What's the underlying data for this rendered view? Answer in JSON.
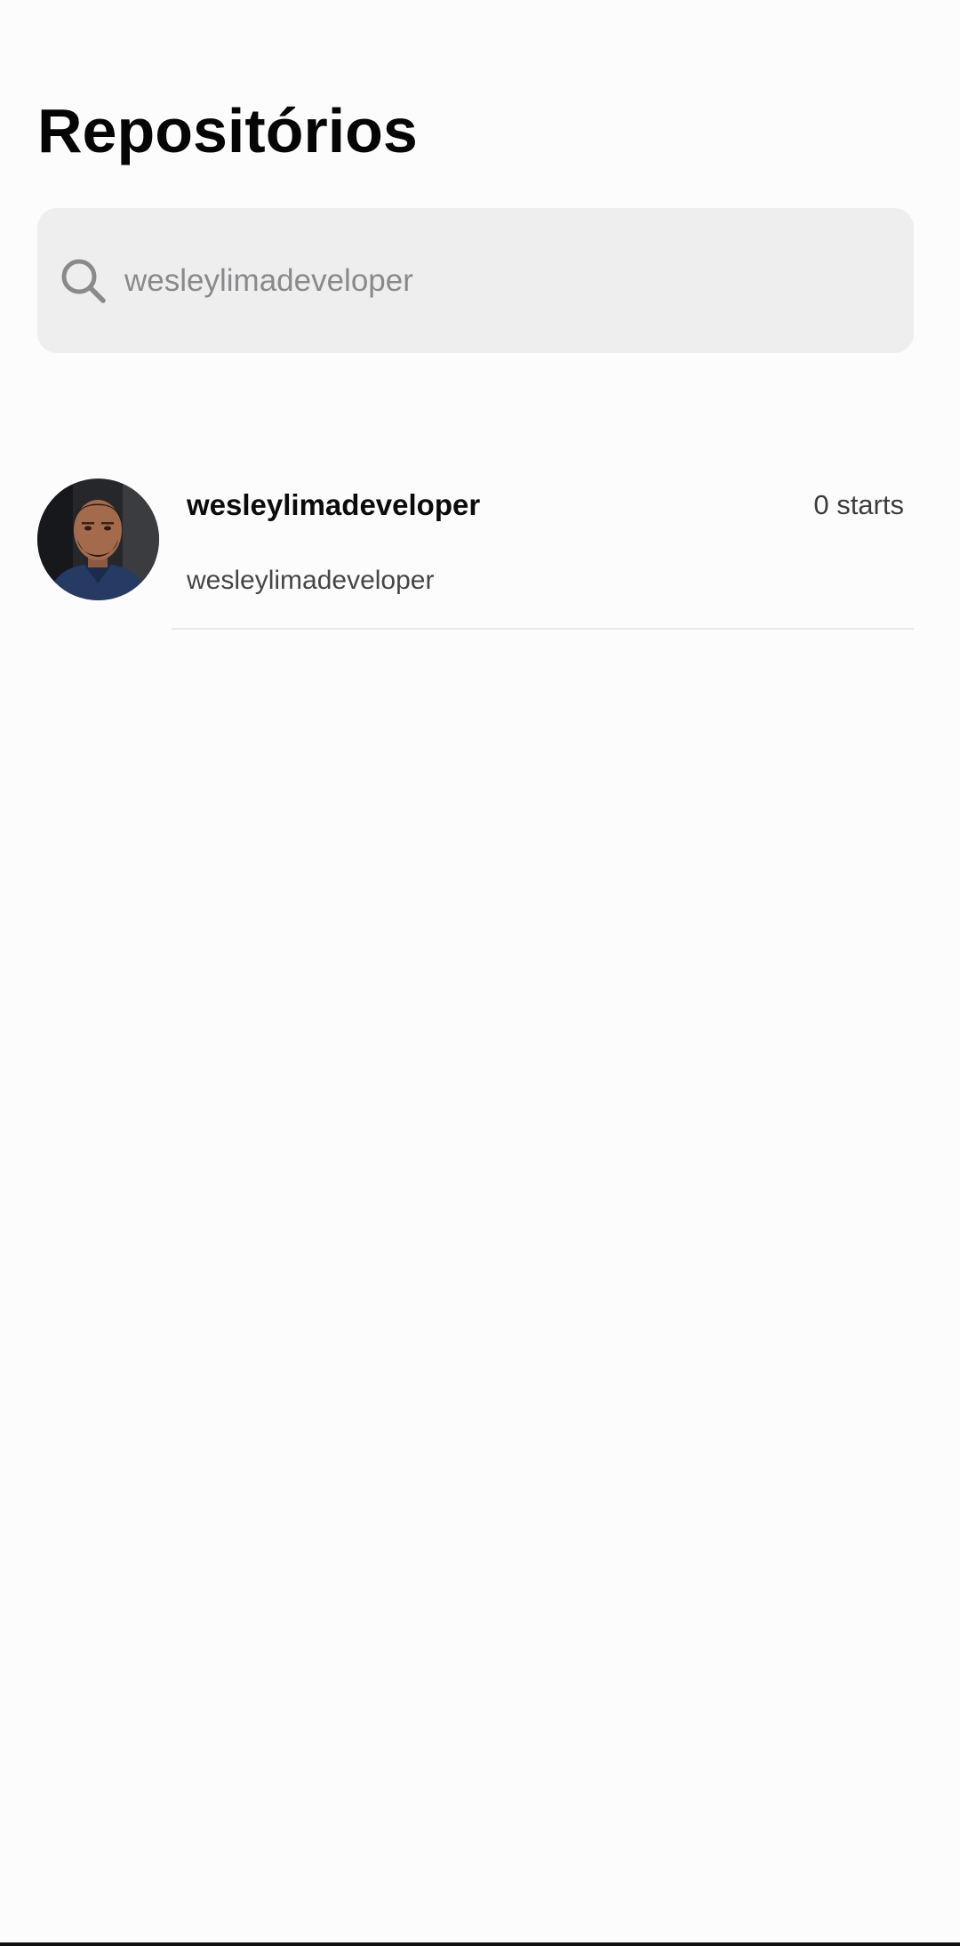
{
  "header": {
    "title": "Repositórios"
  },
  "search": {
    "icon": "search-icon",
    "value": "",
    "placeholder": "wesleylimadeveloper"
  },
  "repositories": [
    {
      "name": "wesleylimadeveloper",
      "owner": "wesleylimadeveloper",
      "stars_label": "0 starts",
      "avatar_icon": "avatar"
    }
  ],
  "colors": {
    "background": "#fdfcfc",
    "search_background": "#eeeeef",
    "title": "#050505",
    "muted_text": "#8a8a8d",
    "separator": "#e9e9ea"
  }
}
